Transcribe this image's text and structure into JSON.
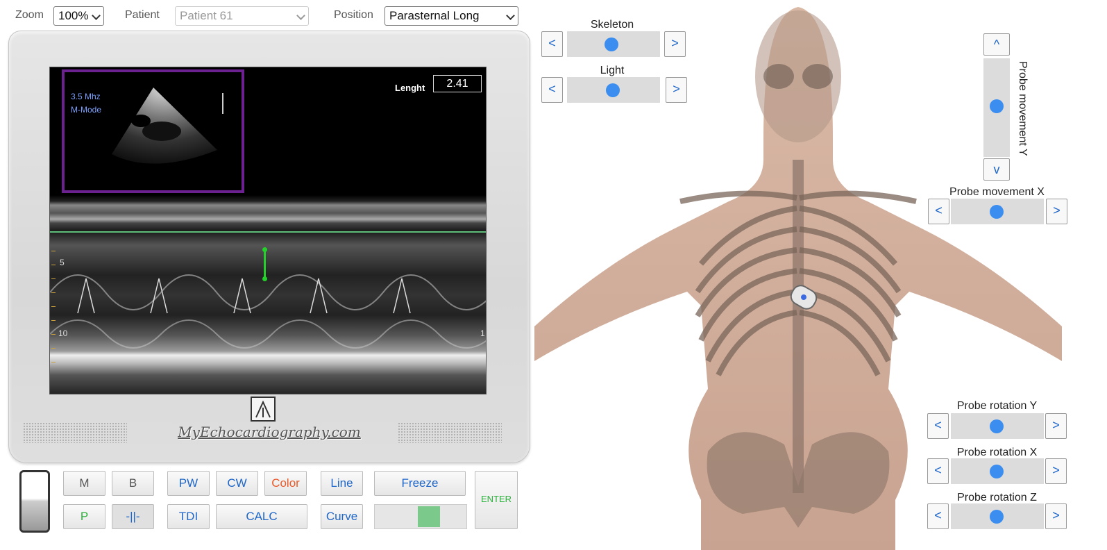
{
  "toolbar": {
    "zoom_label": "Zoom",
    "zoom_value": "100%",
    "patient_label": "Patient",
    "patient_value": "Patient 61",
    "position_label": "Position",
    "position_value": "Parasternal Long"
  },
  "screen": {
    "frequency": "3.5 Mhz",
    "mode": "M-Mode",
    "length_label": "Lenght",
    "length_value": "2.41",
    "depth_ticks": [
      "5",
      "10"
    ],
    "right_marker": "1"
  },
  "brand": "MyEchocardiography.com",
  "controls": {
    "m": "M",
    "b": "B",
    "pw": "PW",
    "cw": "CW",
    "color": "Color",
    "line": "Line",
    "freeze": "Freeze",
    "p": "P",
    "divider": "-||-",
    "tdi": "TDI",
    "calc": "CALC",
    "curve": "Curve",
    "enter": "ENTER",
    "gain_level": 0.55
  },
  "body_panel": {
    "skeleton_label": "Skeleton",
    "light_label": "Light",
    "probe_y_label": "Probe movement Y",
    "probe_x_label": "Probe movement X",
    "rot_y_label": "Probe rotation Y",
    "rot_x_label": "Probe rotation X",
    "rot_z_label": "Probe rotation Z",
    "left_arrow": "<",
    "right_arrow": ">",
    "up_arrow": "^",
    "down_arrow": "v",
    "skeleton_level": 0.5,
    "light_level": 0.5,
    "probe_y_level": 0.5,
    "probe_x_level": 0.5,
    "rot_y_level": 0.5,
    "rot_x_level": 0.5,
    "rot_z_level": 0.5
  },
  "colors": {
    "accent": "#1e66c8",
    "slider_knob": "#3b8ef0",
    "thumb_border": "#6b2290",
    "caliper": "#23d12a"
  }
}
